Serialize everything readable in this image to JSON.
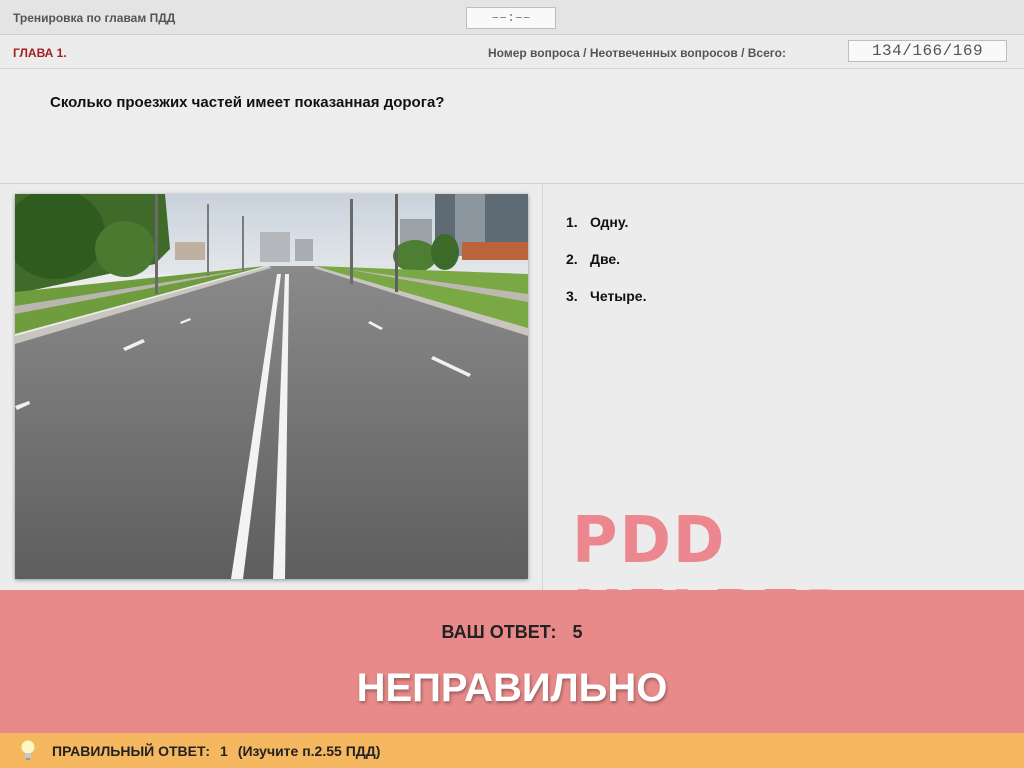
{
  "header": {
    "app_title": "Тренировка по главам ПДД",
    "timer": "––:––"
  },
  "chapter_bar": {
    "chapter": "ГЛАВА 1.",
    "counter_label": "Номер вопроса / Неотвеченных вопросов / Всего:",
    "counter": "134/166/169"
  },
  "question": {
    "text": "Сколько проезжих частей имеет показанная дорога?"
  },
  "answers": [
    {
      "num": "1.",
      "label": "Одну."
    },
    {
      "num": "2.",
      "label": "Две."
    },
    {
      "num": "3.",
      "label": "Четыре."
    }
  ],
  "watermark": "PDD HELPER",
  "result": {
    "your_answer_label": "ВАШ  ОТВЕТ:",
    "your_answer_value": "5",
    "verdict": "НЕПРАВИЛЬНО",
    "background": "#e88a8a"
  },
  "hint": {
    "label": "ПРАВИЛЬНЫЙ ОТВЕТ:",
    "value": "1",
    "note": "(Изучите п.2.55 ПДД)",
    "icon": "lightbulb-icon",
    "background": "#f5b860"
  }
}
